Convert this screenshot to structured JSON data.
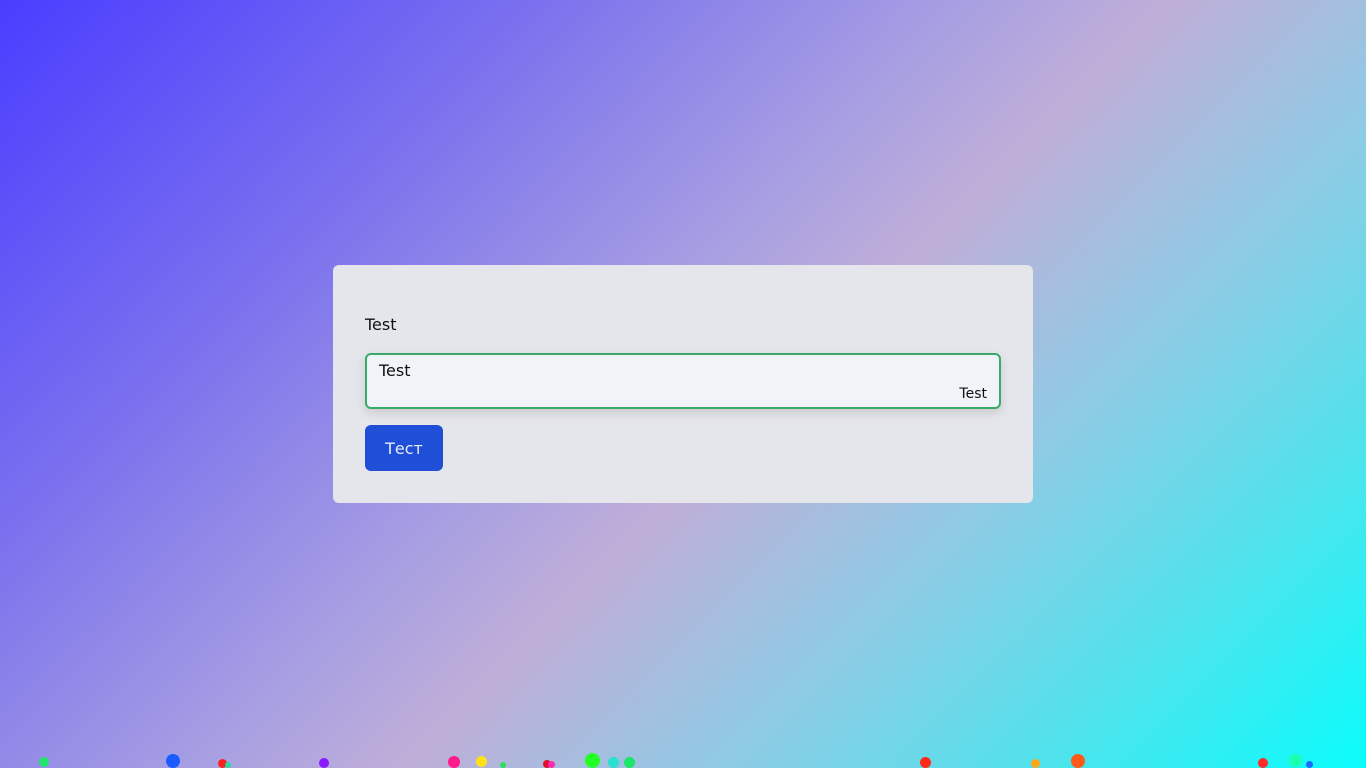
{
  "form": {
    "label": "Test",
    "field_value": "Test",
    "field_hint": "Test",
    "button_label": "Тест"
  },
  "colors": {
    "accent_border": "#3aaa6a",
    "button": "#1e4fd6",
    "card": "#e5e6eb"
  }
}
